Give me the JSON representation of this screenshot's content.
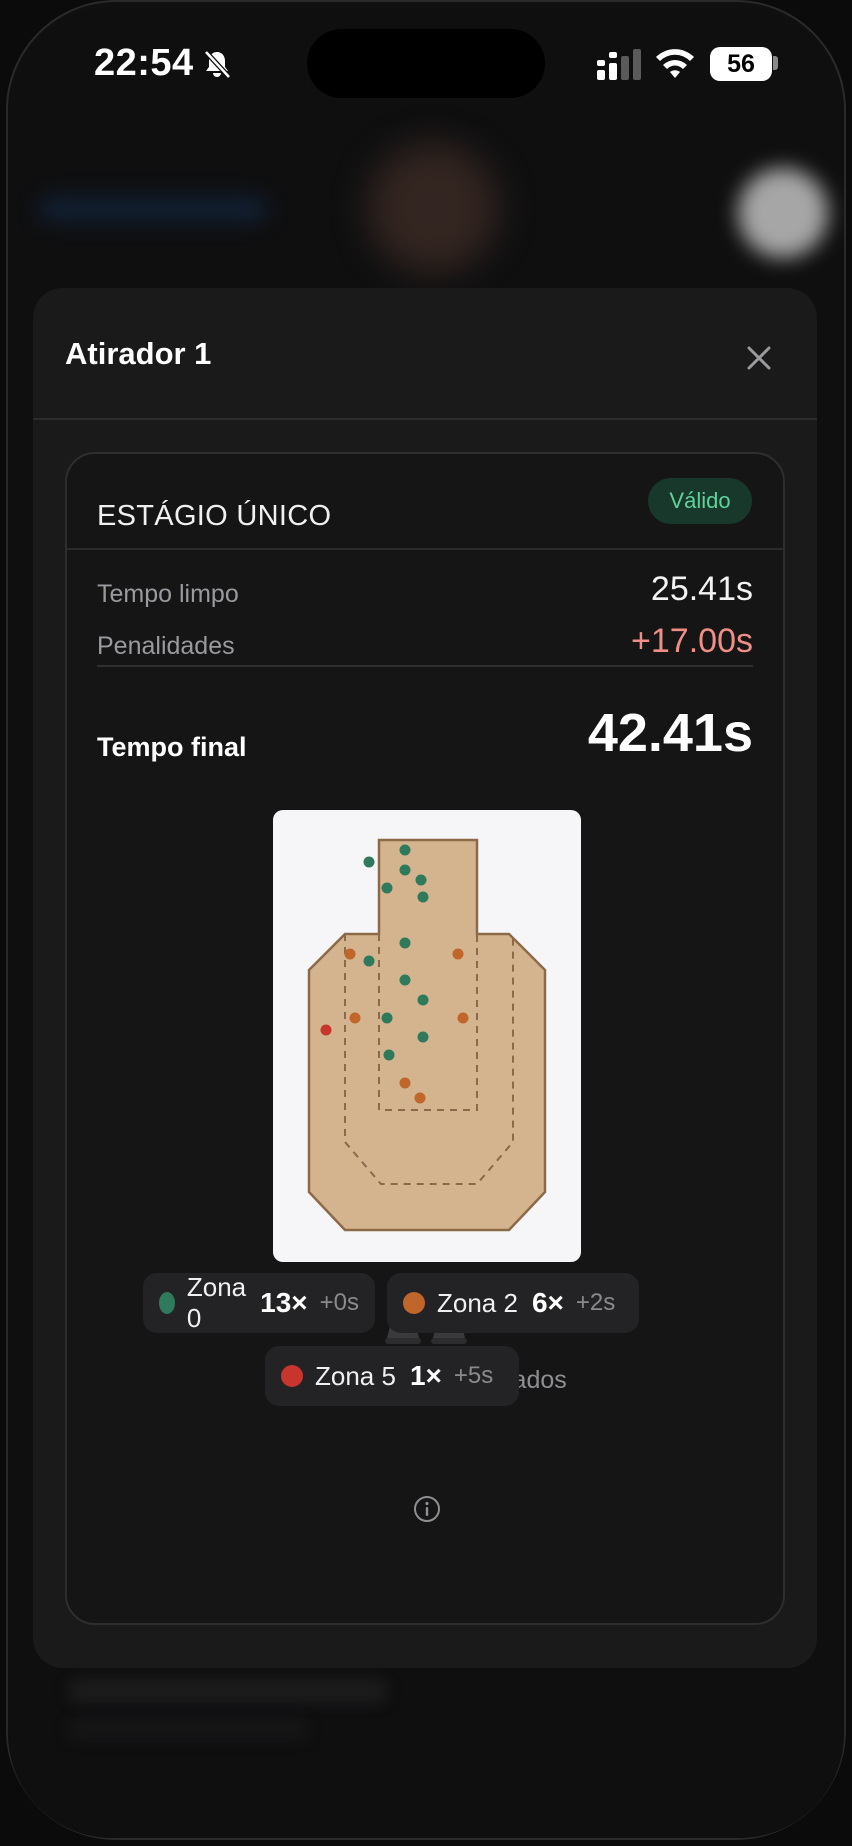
{
  "status_bar": {
    "time": "22:54",
    "battery": "56"
  },
  "modal": {
    "title": "Atirador 1",
    "close_icon": "close-icon"
  },
  "stage": {
    "title": "ESTÁGIO ÚNICO",
    "badge": "Válido",
    "rows": [
      {
        "label": "Tempo limpo",
        "value": "25.41s"
      },
      {
        "label": "Penalidades",
        "value": "+17.00s"
      }
    ],
    "final": {
      "label": "Tempo final",
      "value": "42.41s"
    }
  },
  "target": {
    "colors": {
      "zone0": "#2f7a5c",
      "zone2": "#c0662a",
      "zone5": "#c7352d",
      "paper": "#d3b48f"
    }
  },
  "metals": {
    "count": "2",
    "text": " de 2 metais derrubados"
  },
  "zones": [
    {
      "name": "Zona 0",
      "count": "13×",
      "penalty": "+0s",
      "color": "#2f7a5c"
    },
    {
      "name": "Zona 2",
      "count": "6×",
      "penalty": "+2s",
      "color": "#c0662a"
    },
    {
      "name": "Zona 5",
      "count": "1×",
      "penalty": "+5s",
      "color": "#c7352d"
    }
  ],
  "accent_colors": {
    "valid": "#5fd39a",
    "penalty": "#ee8e86"
  }
}
